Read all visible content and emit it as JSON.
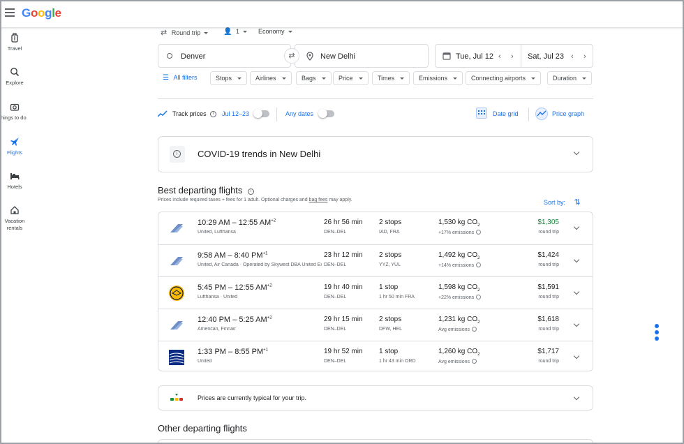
{
  "header": {
    "logo": "Google"
  },
  "sidebar": {
    "items": [
      {
        "label": "Travel"
      },
      {
        "label": "Explore"
      },
      {
        "label": "Things to do"
      },
      {
        "label": "Flights"
      },
      {
        "label": "Hotels"
      },
      {
        "label": "Vacation rentals"
      }
    ]
  },
  "search": {
    "trip_type": "Round trip",
    "passengers": "1",
    "cabin": "Economy",
    "origin": "Denver",
    "destination": "New Delhi",
    "depart_date": "Tue, Jul 12",
    "return_date": "Sat, Jul 23"
  },
  "filters": [
    {
      "label": "All filters"
    },
    {
      "label": "Stops"
    },
    {
      "label": "Airlines"
    },
    {
      "label": "Bags"
    },
    {
      "label": "Price"
    },
    {
      "label": "Times"
    },
    {
      "label": "Emissions"
    },
    {
      "label": "Connecting airports"
    },
    {
      "label": "Duration"
    }
  ],
  "tracking": {
    "label": "Track prices",
    "range": "Jul 12–23",
    "any_dates": "Any dates",
    "date_grid": "Date grid",
    "price_graph": "Price graph"
  },
  "covid": {
    "title": "COVID-19 trends in New Delhi"
  },
  "best": {
    "title": "Best departing flights",
    "note_prefix": "Prices include required taxes + fees for 1 adult. Optional charges and ",
    "note_link": "bag fees",
    "note_suffix": " may apply.",
    "sort_label": "Sort by:"
  },
  "flights": [
    {
      "depart": "10:29 AM",
      "arrive": "12:55 AM",
      "plus": "+2",
      "airline": "United, Lufthansa",
      "duration": "26 hr 56 min",
      "route": "DEN–DEL",
      "stops": "2 stops",
      "stop_detail": "IAD, FRA",
      "co2": "1,530 kg CO",
      "emissions": "+17% emissions",
      "price": "$1,305",
      "price_type": "round trip",
      "price_color": "#188038",
      "logo": "united-lufthansa"
    },
    {
      "depart": "9:58 AM",
      "arrive": "8:40 PM",
      "plus": "+1",
      "airline": "United, Air Canada · Operated by Skywest DBA United Express",
      "duration": "23 hr 12 min",
      "route": "DEN–DEL",
      "stops": "2 stops",
      "stop_detail": "YYZ, YUL",
      "co2": "1,492 kg CO",
      "emissions": "+14% emissions",
      "price": "$1,424",
      "price_type": "round trip",
      "price_color": "#202124",
      "logo": "united"
    },
    {
      "depart": "5:45 PM",
      "arrive": "12:55 AM",
      "plus": "+2",
      "airline": "Lufthansa · United",
      "duration": "19 hr 40 min",
      "route": "DEN–DEL",
      "stops": "1 stop",
      "stop_detail": "1 hr 50 min FRA",
      "co2": "1,598 kg CO",
      "emissions": "+22% emissions",
      "price": "$1,591",
      "price_type": "round trip",
      "price_color": "#202124",
      "logo": "lufthansa"
    },
    {
      "depart": "12:40 PM",
      "arrive": "5:25 AM",
      "plus": "+2",
      "airline": "American, Finnair",
      "duration": "29 hr 15 min",
      "route": "DEN–DEL",
      "stops": "2 stops",
      "stop_detail": "DFW, HEL",
      "co2": "1,231 kg CO",
      "emissions": "Avg emissions",
      "price": "$1,618",
      "price_type": "round trip",
      "price_color": "#202124",
      "logo": "american"
    },
    {
      "depart": "1:33 PM",
      "arrive": "8:55 PM",
      "plus": "+1",
      "airline": "United",
      "duration": "19 hr 52 min",
      "route": "DEN–DEL",
      "stops": "1 stop",
      "stop_detail": "1 hr 43 min ORD",
      "co2": "1,260 kg CO",
      "emissions": "Avg emissions",
      "price": "$1,717",
      "price_type": "round trip",
      "price_color": "#202124",
      "logo": "united-globe"
    }
  ],
  "typical": {
    "text": "Prices are currently typical for your trip."
  },
  "other": {
    "title": "Other departing flights"
  }
}
